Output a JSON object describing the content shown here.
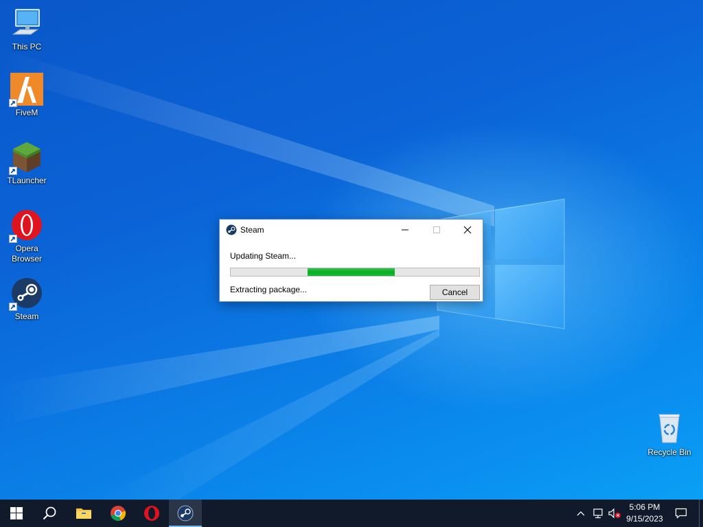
{
  "desktop": {
    "icons": [
      {
        "label": "This PC",
        "icon": "this-pc-icon"
      },
      {
        "label": "FiveM",
        "icon": "fivem-icon"
      },
      {
        "label": "TLauncher",
        "icon": "tlauncher-icon"
      },
      {
        "label": "Opera Browser",
        "icon": "opera-icon"
      },
      {
        "label": "Steam",
        "icon": "steam-icon"
      },
      {
        "label": "Recycle Bin",
        "icon": "recycle-bin-icon"
      }
    ]
  },
  "dialog": {
    "title": "Steam",
    "status_top": "Updating Steam...",
    "status_bottom": "Extracting package...",
    "cancel_label": "Cancel",
    "progress": {
      "start": 0.31,
      "end": 0.66
    },
    "progress_color": "#06b025"
  },
  "taskbar": {
    "apps": [
      "start-icon",
      "search-icon",
      "file-explorer-icon",
      "chrome-icon",
      "opera-icon",
      "steam-icon"
    ],
    "active_app": "steam",
    "tray": {
      "time": "5:06 PM",
      "date": "9/15/2023",
      "icons": [
        "chevron-up-icon",
        "network-icon",
        "volume-muted-icon",
        "notification-icon"
      ]
    }
  },
  "colors": {
    "accent": "#0078d7",
    "taskbar": "#101a2b"
  }
}
